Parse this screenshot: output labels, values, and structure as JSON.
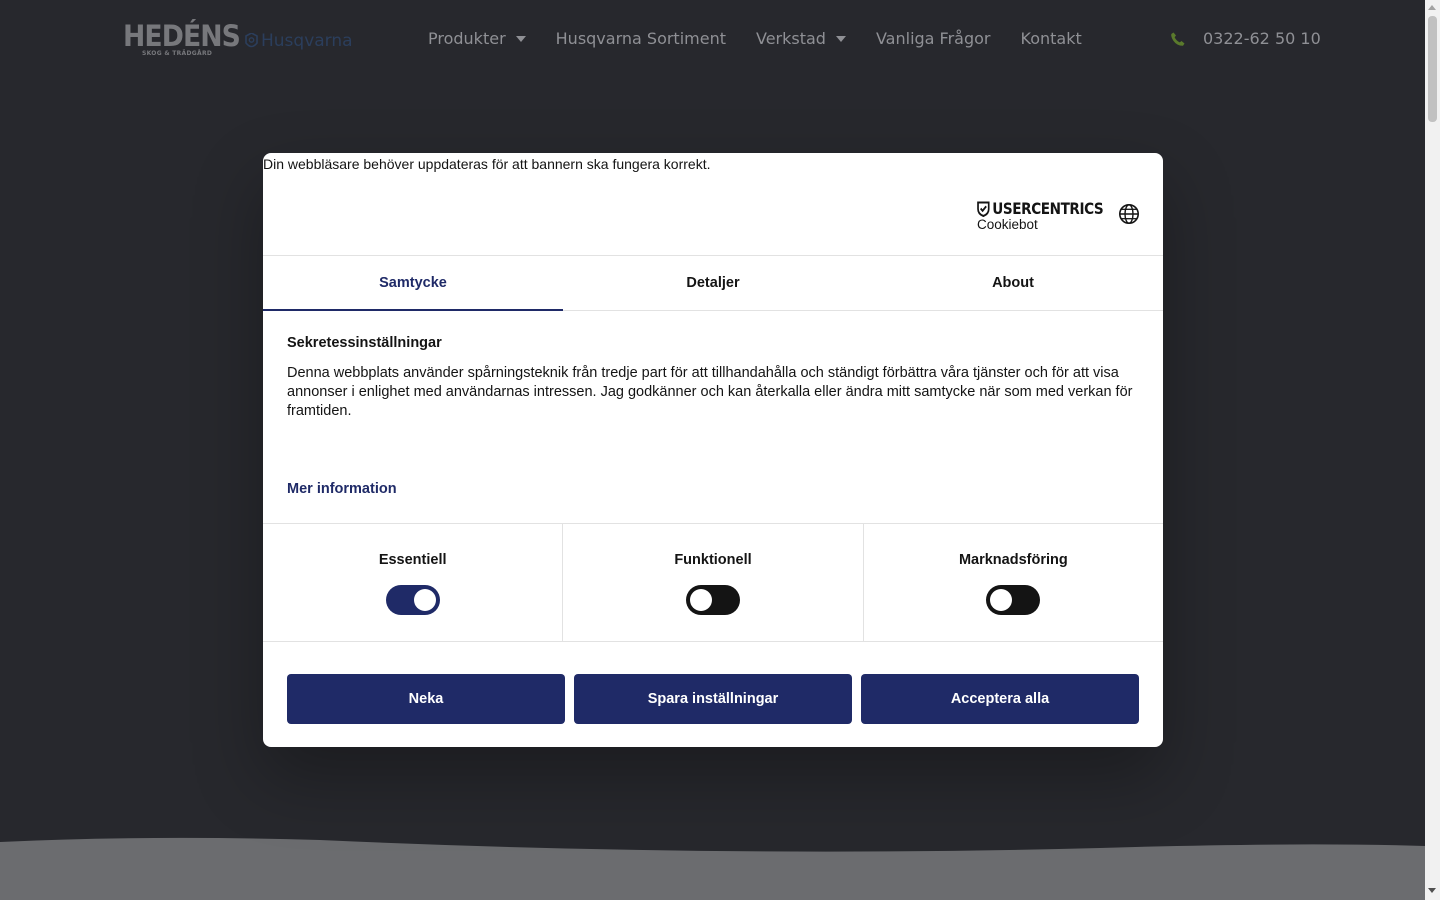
{
  "header": {
    "logo_text": "HEDÉNS",
    "logo_subtext": "SKOG & TRÄDGÅRD",
    "partner_logo_text": "Husqvarna",
    "nav": [
      {
        "label": "Produkter",
        "has_dropdown": true
      },
      {
        "label": "Husqvarna Sortiment",
        "has_dropdown": false
      },
      {
        "label": "Verkstad",
        "has_dropdown": true
      },
      {
        "label": "Vanliga Frågor",
        "has_dropdown": false
      },
      {
        "label": "Kontakt",
        "has_dropdown": false
      }
    ],
    "phone": "0322-62 50 10",
    "phone_icon": "phone-icon",
    "phone_icon_color": "#5a7a2c"
  },
  "dialog": {
    "browser_notice": "Din webbläsare behöver uppdateras för att bannern ska fungera korrekt.",
    "brand_name": "USERCENTRICS",
    "brand_sub": "Cookiebot",
    "language_icon": "globe-icon",
    "tabs": [
      {
        "label": "Samtycke",
        "active": true
      },
      {
        "label": "Detaljer",
        "active": false
      },
      {
        "label": "About",
        "active": false
      }
    ],
    "title": "Sekretessinställningar",
    "text": "Denna webbplats använder spårningsteknik från tredje part för att tillhandahålla och ständigt förbättra våra tjänster och för att visa annonser i enlighet med användarnas intressen. Jag godkänner och kan återkalla eller ändra mitt samtycke när som med verkan för framtiden.",
    "more_info": "Mer information",
    "toggles": [
      {
        "label": "Essentiell",
        "on": true
      },
      {
        "label": "Funktionell",
        "on": false
      },
      {
        "label": "Marknadsföring",
        "on": false
      }
    ],
    "buttons": {
      "deny": "Neka",
      "save": "Spara inställningar",
      "accept_all": "Acceptera alla"
    }
  },
  "colors": {
    "accent": "#1f2a67",
    "overlay_background": "#27282d",
    "toggle_off": "#141414"
  }
}
